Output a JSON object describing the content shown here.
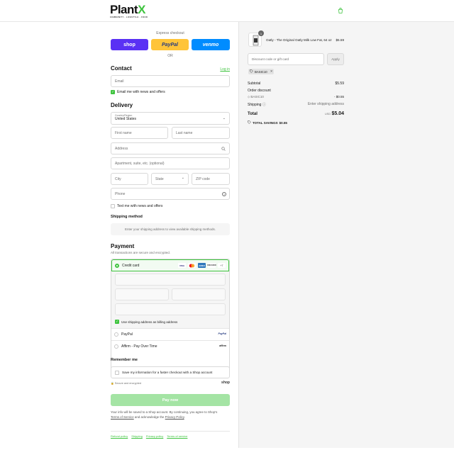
{
  "brand": {
    "name_main": "Plant",
    "name_x": "X",
    "tagline": "COMMUNITY · LIFESTYLE · FOOD"
  },
  "express": {
    "title": "Express checkout",
    "shop_label": "shop",
    "paypal_label": "PayPal",
    "venmo_label": "venmo",
    "or_label": "OR"
  },
  "contact": {
    "heading": "Contact",
    "login_label": "Log in",
    "email_placeholder": "Email",
    "news_label": "Email me with news and offers"
  },
  "delivery": {
    "heading": "Delivery",
    "country_label": "Country/Region",
    "country_value": "United States",
    "first_name": "First name",
    "last_name": "Last name",
    "address": "Address",
    "apartment": "Apartment, suite, etc. (optional)",
    "city": "City",
    "state": "State",
    "zip": "ZIP code",
    "phone": "Phone",
    "text_label": "Text me with news and offers"
  },
  "shipping_method": {
    "heading": "Shipping method",
    "note": "Enter your shipping address to view available shipping methods."
  },
  "payment": {
    "heading": "Payment",
    "subtitle": "All transactions are secure and encrypted.",
    "credit_card_label": "Credit card",
    "card_brands": [
      "VISA",
      "MC",
      "AMEX",
      "DISCOVER"
    ],
    "more_cards": "+7",
    "billing_same_label": "Use shipping address as billing address",
    "paypal_label": "PayPal",
    "paypal_logo": "PayPal",
    "affirm_label": "Affirm - Pay Over Time",
    "affirm_logo": "affirm"
  },
  "remember": {
    "heading": "Remember me",
    "save_label": "Save my information for a faster checkout with a Shop account",
    "secure_label": "Secure and encrypted",
    "shop_logo": "shop"
  },
  "pay_button": "Pay now",
  "legal": {
    "line1": "Your info will be saved to a Shop account. By continuing, you agree to Shop's",
    "terms": "Terms of Service",
    "mid": " and acknowledge the ",
    "privacy": "Privacy Policy",
    "end": "."
  },
  "footer_links": [
    "Refund policy",
    "Shipping",
    "Privacy policy",
    "Terms of service"
  ],
  "order": {
    "item_qty": "1",
    "item_name": "Oatly - The Original Oatly Milk Low Fat, 64 oz",
    "item_price": "$5.59",
    "discount_placeholder": "Discount code or gift card",
    "apply_label": "Apply",
    "code": "BASIC10",
    "subtotal_label": "Subtotal",
    "subtotal_value": "$5.59",
    "order_discount_label": "Order discount",
    "discount_code": "BASIC10",
    "discount_value": "- $0.55",
    "shipping_label": "Shipping",
    "shipping_value": "Enter shipping address",
    "total_label": "Total",
    "currency": "USD",
    "total_value": "$5.04",
    "savings_label": "TOTAL SAVINGS",
    "savings_value": "$0.55"
  },
  "colors": {
    "accent": "#3fc43f",
    "shop": "#5a31f4",
    "paypal": "#ffc439",
    "venmo": "#008cff"
  }
}
